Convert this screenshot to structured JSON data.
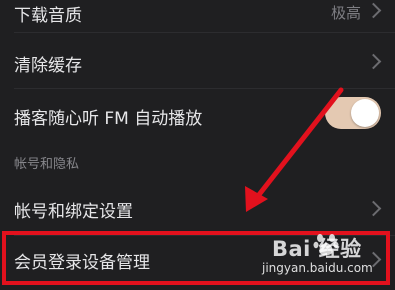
{
  "settings": {
    "download_quality": {
      "label": "下载音质",
      "value": "极高"
    },
    "clear_cache": {
      "label": "清除缓存"
    },
    "podcast_autoplay": {
      "label": "播客随心听 FM 自动播放",
      "enabled": true
    }
  },
  "account_section": {
    "title": "帐号和隐私",
    "binding": {
      "label": "帐号和绑定设置"
    },
    "device_management": {
      "label": "会员登录设备管理"
    }
  },
  "watermark": {
    "main": "Bai 经验",
    "sub": "jingyan.baidu.com"
  },
  "colors": {
    "highlight": "#e2111d",
    "toggle_on": "#e4c9b2",
    "arrow": "#e2111d"
  }
}
